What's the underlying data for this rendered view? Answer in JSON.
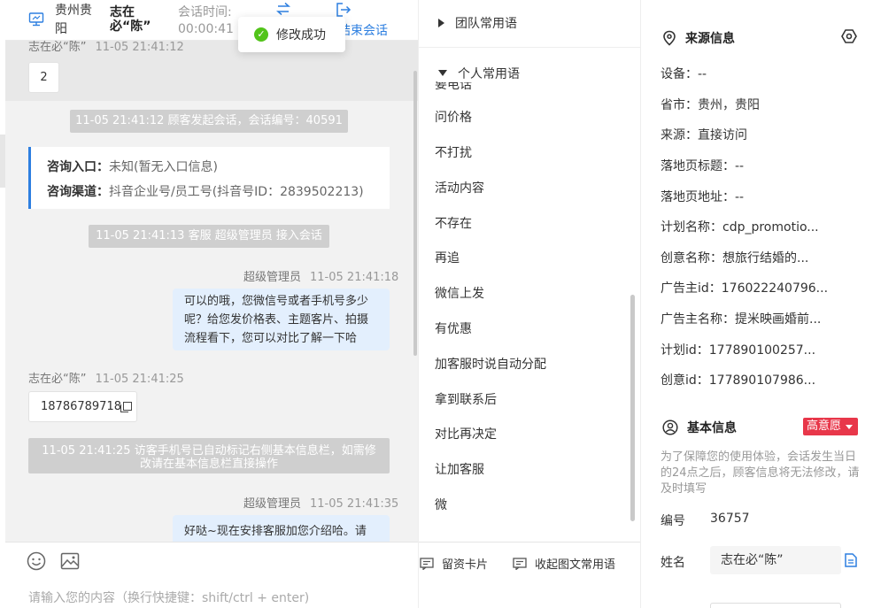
{
  "header": {
    "location": "贵州贵阳",
    "visitor_name": "志在必“陈”",
    "session_time_label": "会话时间:",
    "session_time_value": "00:00:41",
    "end_session_label": "结束会话"
  },
  "toast": {
    "text": "修改成功"
  },
  "messages": {
    "m1": {
      "sender": "志在必“陈”",
      "time": "11-05 21:41:12",
      "text": "2"
    },
    "sys1": "11-05 21:41:12 顾客发起会话，会话编号：40591",
    "consult": {
      "entry_label": "咨询入口：",
      "entry_value": "未知(暂无入口信息)",
      "channel_label": "咨询渠道：",
      "channel_value": "抖音企业号/员工号(抖音号ID：2839502213)"
    },
    "sys2": "11-05 21:41:13 客服 超级管理员 接入会话",
    "m2": {
      "sender": "超级管理员",
      "time": "11-05 21:41:18",
      "text": "可以的哦，您微信号或者手机号多少呢？给您发价格表、主题客片、拍摄流程看下，您可以对比了解一下哈"
    },
    "m3": {
      "sender": "志在必“陈”",
      "time": "11-05 21:41:25",
      "text": "18786789718"
    },
    "sys3": "11-05 21:41:25 访客手机号已自动标记右侧基本信息栏，如需修改请在基本信息栏直接操作",
    "m4": {
      "sender": "超级管理员",
      "time": "11-05 21:41:35",
      "text": "好哒~现在安排客服加您介绍哈。请"
    }
  },
  "input": {
    "placeholder": "请输入您的内容（换行快捷键：shift/ctrl + enter)"
  },
  "phrases": {
    "team_label": "团队常用语",
    "personal_label": "个人常用语",
    "clipped_item": "要电话",
    "items": [
      "问价格",
      "不打扰",
      "活动内容",
      "不存在",
      "再追",
      "微信上发",
      "有优惠",
      "加客服时说自动分配",
      "拿到联系后",
      "对比再决定",
      "让加客服",
      "微"
    ],
    "leave_card_label": "留资卡片",
    "rich_phrase_label": "收起图文常用语"
  },
  "source_info": {
    "title": "来源信息",
    "device": "设备：--",
    "region": "省市：贵州，贵阳",
    "source": "来源：直接访问",
    "landing_title": "落地页标题：--",
    "landing_url": "落地页地址：--",
    "plan_name": "计划名称：cdp_promotio...",
    "creative_name": "创意名称：想旅行结婚的...",
    "advertiser_id": "广告主id：176022240796...",
    "advertiser_name": "广告主名称：提米映画婚前...",
    "plan_id": "计划id：177890100257...",
    "creative_id": "创意id：177890107986..."
  },
  "basic_info": {
    "title": "基本信息",
    "intent_badge": "高意愿",
    "notice": "为了保障您的使用体验，会话发生当日的24点之后，顾客信息将无法修改，请及时填写",
    "number_label": "编号",
    "number_value": "36757",
    "name_label": "姓名",
    "name_value": "志在必“陈”"
  },
  "colors": {
    "accent": "#2d7fe0",
    "success": "#52c41a",
    "badge": "#e8374a",
    "customer_bubble": "#e3effd",
    "system_note": "#cfcfcf"
  }
}
